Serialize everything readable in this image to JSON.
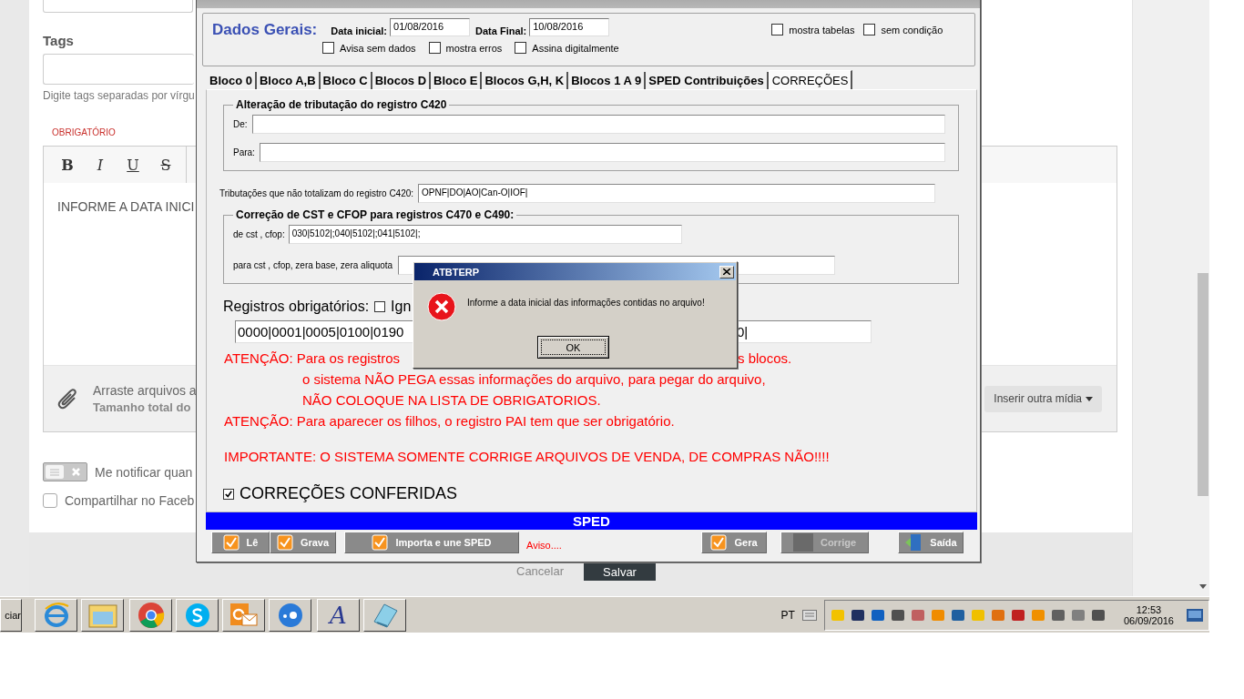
{
  "web_page": {
    "tags_label": "Tags",
    "tags_hint": "Digite tags separadas por vírgu",
    "required_label": "OBRIGATÓRIO",
    "editor_tools": [
      {
        "kind": "bold",
        "label": "B"
      },
      {
        "kind": "italic",
        "label": "I"
      },
      {
        "kind": "underline",
        "label": "U"
      },
      {
        "kind": "strike",
        "label": "S"
      }
    ],
    "editor_text": "INFORME A DATA INICI",
    "attach_text": "Arraste arquivos a",
    "attach_size": "Tamanho total do",
    "media_button": "Inserir outra mídia",
    "notify": {
      "label": "Me notificar quan",
      "on": false
    },
    "share": {
      "label": "Compartilhar no Faceb",
      "checked": false
    },
    "cancel": "Cancelar",
    "save": "Salvar"
  },
  "sped_window": {
    "heading": "Dados Gerais:",
    "dates": [
      {
        "label": "Data inicial:",
        "value": "01/08/2016"
      },
      {
        "label": "Data Final:",
        "value": "10/08/2016"
      }
    ],
    "options_top": [
      {
        "label": "mostra tabelas",
        "checked": false
      },
      {
        "label": "sem condição",
        "checked": false
      }
    ],
    "options": [
      {
        "label": "Avisa sem dados",
        "checked": false
      },
      {
        "label": "mostra erros",
        "checked": false
      },
      {
        "label": "Assina digitalmente",
        "checked": false
      }
    ],
    "tabs": [
      {
        "label": "Bloco 0",
        "selected": false
      },
      {
        "label": "Bloco A,B",
        "selected": false
      },
      {
        "label": "Bloco C",
        "selected": false
      },
      {
        "label": "Blocos D",
        "selected": false
      },
      {
        "label": "Bloco E",
        "selected": false
      },
      {
        "label": "Blocos G,H, K",
        "selected": false
      },
      {
        "label": "Blocos 1 A 9",
        "selected": false
      },
      {
        "label": "SPED Contribuições",
        "selected": false
      },
      {
        "label": "CORREÇÕES",
        "selected": true
      }
    ],
    "c420_group": {
      "legend": "Alteração de tributação do registro C420",
      "fields": [
        {
          "label": "De:"
        },
        {
          "label": "Para:"
        }
      ]
    },
    "untotaled": {
      "label": "Tributações que não totalizam do registro C420:",
      "value": "OPNF|DO|AO|Can-O|IOF|"
    },
    "cst_group": {
      "legend": "Correção de CST e CFOP para registros C470 e C490:",
      "fields": [
        {
          "label": "de cst , cfop:",
          "value": "030|5102|;040|5102|;041|5102|;"
        },
        {
          "label": "para cst , cfop, zera base, zera aliquota"
        }
      ]
    },
    "required": {
      "label": "Registros obrigatórios:",
      "ignore": {
        "label": "Ign",
        "checked": false
      },
      "value_start": "0000|0001|0005|0100|0190",
      "value_end": "0|"
    },
    "warnings": [
      {
        "text": "ATENÇÃO: Para os registros",
        "tail": "s blocos.",
        "indent": false
      },
      {
        "text": "o sistema NÃO PEGA essas informações do arquivo, para pegar do arquivo,",
        "indent": true
      },
      {
        "text": "NÃO COLOQUE NA LISTA DE OBRIGATORIOS.",
        "indent": true
      },
      {
        "text": "ATENÇÃO: Para aparecer os filhos, o registro PAI tem que ser obrigatório.",
        "indent": false
      }
    ],
    "important": "IMPORTANTE: O SISTEMA SOMENTE CORRIGE ARQUIVOS DE VENDA, DE COMPRAS NÃO!!!!",
    "confirmed": {
      "label": "CORREÇÕES CONFERIDAS",
      "checked": true
    },
    "status_bar": "SPED",
    "buttons_left": [
      {
        "label": "Lê",
        "kind": "check",
        "disabled": false
      },
      {
        "label": "Grava",
        "kind": "check",
        "disabled": false
      },
      {
        "label": "Importa e une SPED",
        "kind": "check",
        "disabled": false
      }
    ],
    "notice": "Aviso....",
    "buttons_right": [
      {
        "label": "Gera",
        "kind": "check",
        "disabled": false
      },
      {
        "label": "Corrige",
        "kind": "blank",
        "disabled": true
      },
      {
        "label": "Saída",
        "kind": "exit",
        "disabled": false
      }
    ]
  },
  "dialog": {
    "title": "ATBTERP",
    "message": "Informe a data inicial das informações contidas no arquivo!",
    "ok": "OK"
  },
  "taskbar": {
    "start": "ciar",
    "apps": [
      {
        "kind": "browser"
      },
      {
        "kind": "folder"
      },
      {
        "kind": "chrome"
      },
      {
        "kind": "chat"
      },
      {
        "kind": "mail"
      },
      {
        "kind": "dots"
      },
      {
        "kind": "letter",
        "label": "A"
      },
      {
        "kind": "notepad"
      }
    ],
    "language": "PT",
    "time": "12:53",
    "date": "06/09/2016"
  }
}
